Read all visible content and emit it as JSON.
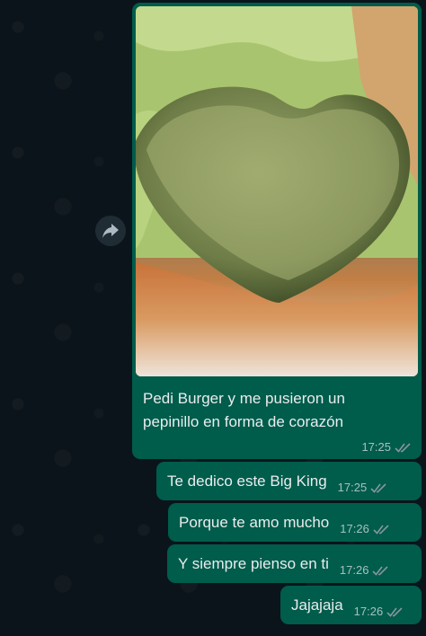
{
  "messages": [
    {
      "type": "image",
      "caption": "Pedi Burger y me pusieron un pepinillo en forma de corazón",
      "time": "17:25",
      "status": "read"
    },
    {
      "type": "text",
      "text": "Te dedico este Big King",
      "time": "17:25",
      "status": "read"
    },
    {
      "type": "text",
      "text": "Porque te amo mucho",
      "time": "17:26",
      "status": "read"
    },
    {
      "type": "text",
      "text": "Y siempre pienso en ti",
      "time": "17:26",
      "status": "read"
    },
    {
      "type": "text",
      "text": "Jajajaja",
      "time": "17:26",
      "status": "read"
    }
  ],
  "icons": {
    "forward": "forward-arrow-icon",
    "read_receipt": "double-check-icon"
  },
  "colors": {
    "chat_background": "#0b141a",
    "outgoing_bubble": "#005c4b",
    "text": "#e9edef",
    "read_receipt": "#8696a0"
  }
}
